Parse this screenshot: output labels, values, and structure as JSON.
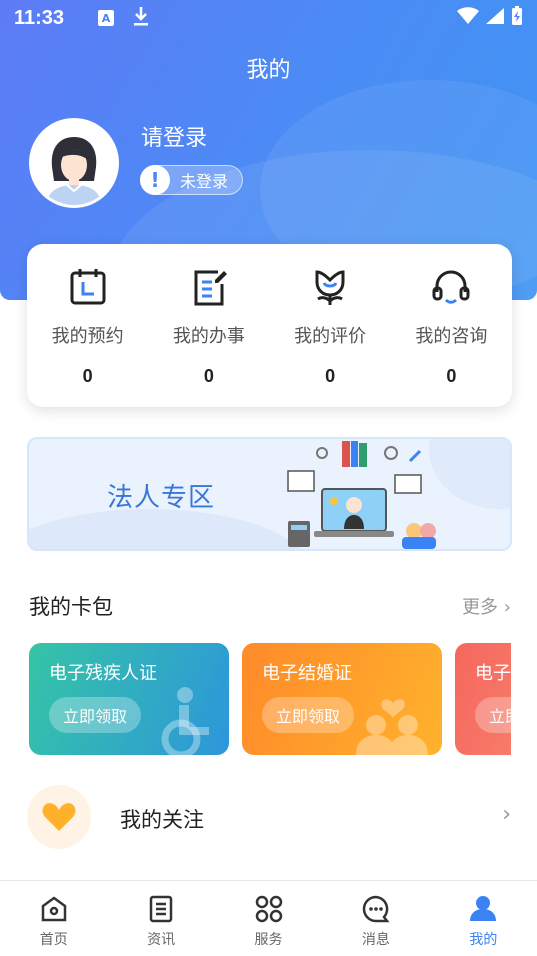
{
  "status_bar": {
    "time": "11:33",
    "a_icon_label": "A"
  },
  "header": {
    "title": "我的",
    "login_prompt": "请登录",
    "login_status": "未登录",
    "status_icon": "!"
  },
  "stats": [
    {
      "label": "我的预约",
      "value": "0",
      "icon": "calendar-icon"
    },
    {
      "label": "我的办事",
      "value": "0",
      "icon": "document-edit-icon"
    },
    {
      "label": "我的评价",
      "value": "0",
      "icon": "flower-smile-icon"
    },
    {
      "label": "我的咨询",
      "value": "0",
      "icon": "headset-icon"
    }
  ],
  "banner": {
    "title": "法人专区"
  },
  "wallet": {
    "title": "我的卡包",
    "more": "更多",
    "cards": [
      {
        "title": "电子残疾人证",
        "button": "立即领取"
      },
      {
        "title": "电子结婚证",
        "button": "立即领取"
      },
      {
        "title": "电子",
        "button": "立即"
      }
    ]
  },
  "follow": {
    "label": "我的关注"
  },
  "tabbar": [
    {
      "label": "首页",
      "icon": "home-icon"
    },
    {
      "label": "资讯",
      "icon": "news-icon"
    },
    {
      "label": "服务",
      "icon": "grid-icon"
    },
    {
      "label": "消息",
      "icon": "chat-icon"
    },
    {
      "label": "我的",
      "icon": "user-icon",
      "active": true
    }
  ],
  "colors": {
    "accent": "#3b82f4",
    "header_start": "#5d7cf6",
    "header_end": "#3f95f3"
  }
}
